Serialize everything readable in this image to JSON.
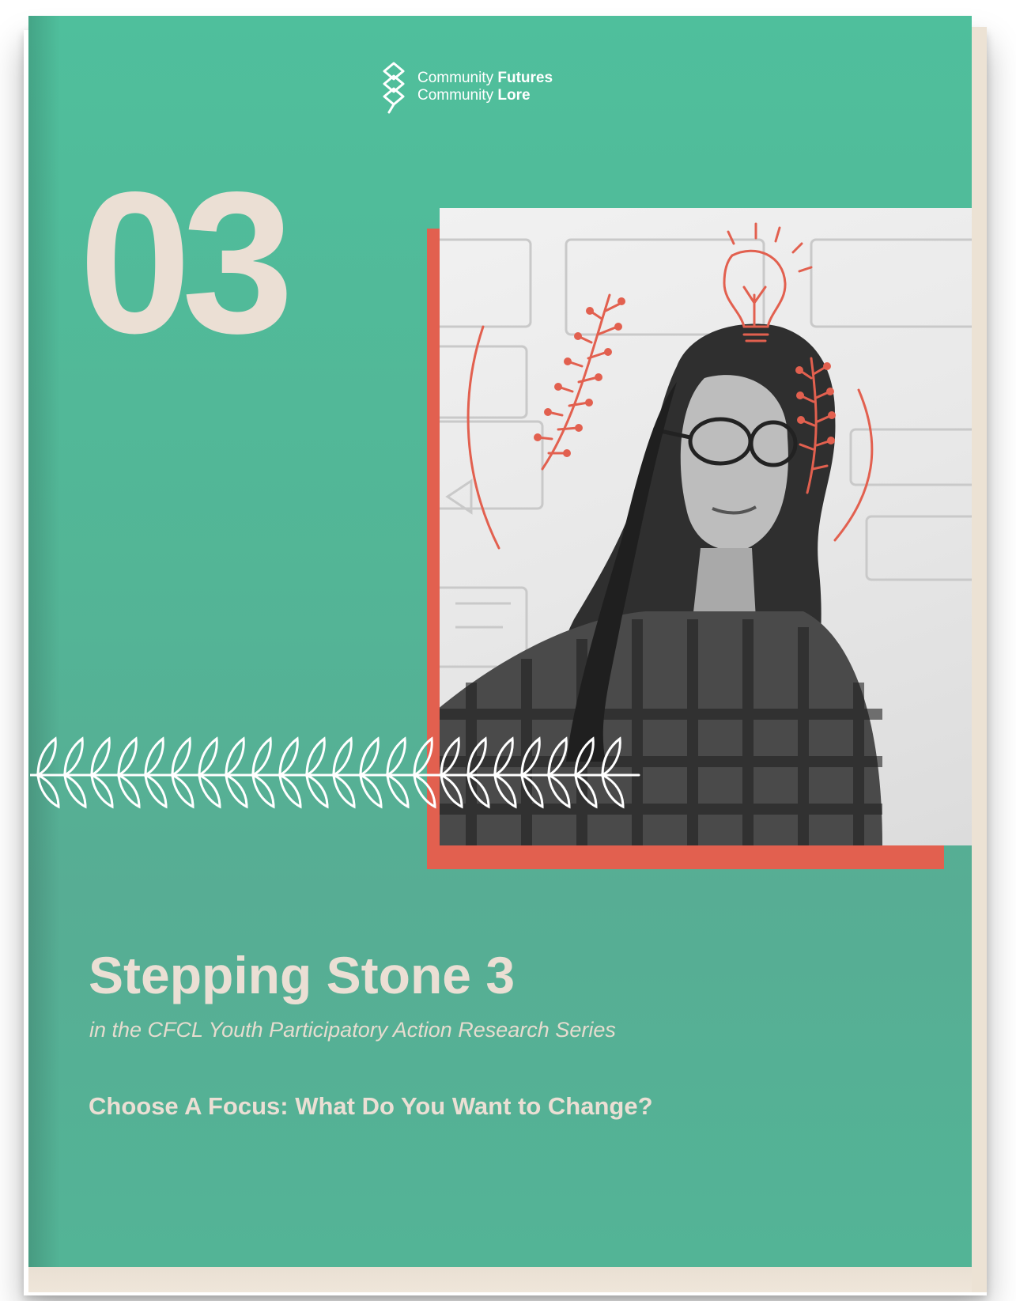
{
  "logo": {
    "line1_regular": "Community ",
    "line1_bold": "Futures",
    "line2_regular": "Community ",
    "line2_bold": "Lore"
  },
  "cover": {
    "number": "03",
    "title": "Stepping Stone 3",
    "subtitle": "in the CFCL Youth Participatory Action Research Series",
    "question": "Choose A Focus: What Do You Want to Change?"
  },
  "colors": {
    "teal": "#53b596",
    "cream": "#ebdfd4",
    "coral": "#e2604f"
  }
}
